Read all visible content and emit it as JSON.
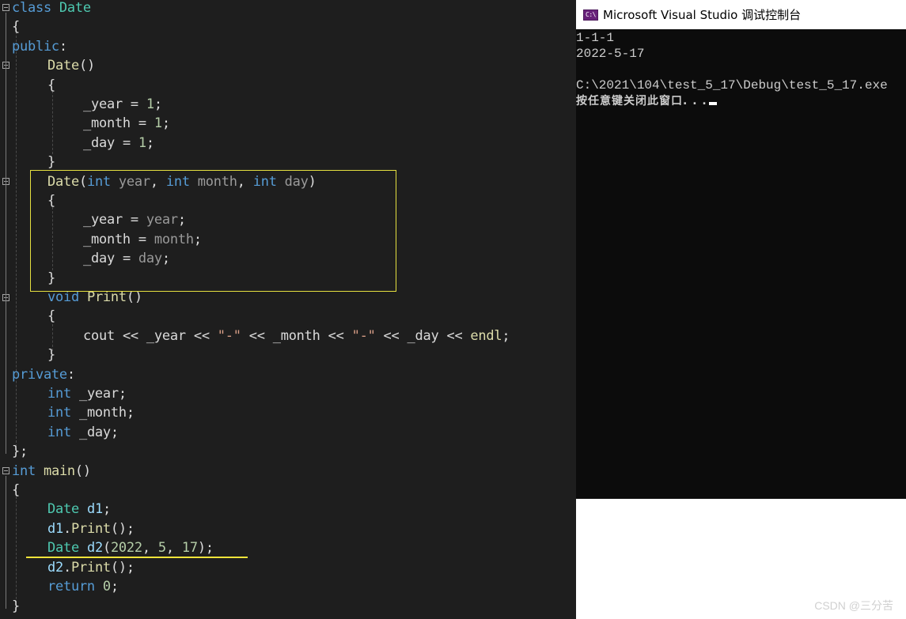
{
  "editor": {
    "lines": [
      [
        "class ",
        "Date"
      ],
      [
        "{"
      ],
      [
        "public",
        ":"
      ],
      [
        "Date",
        "()"
      ],
      [
        "{"
      ],
      [
        "_year",
        " = ",
        "1",
        ";"
      ],
      [
        "_month",
        " = ",
        "1",
        ";"
      ],
      [
        "_day",
        " = ",
        "1",
        ";"
      ],
      [
        "}"
      ],
      [
        "Date",
        "(",
        "int",
        " year",
        ", ",
        "int",
        " month",
        ", ",
        "int",
        " day",
        ")"
      ],
      [
        "{"
      ],
      [
        "_year",
        " = ",
        "year",
        ";"
      ],
      [
        "_month",
        " = ",
        "month",
        ";"
      ],
      [
        "_day",
        " = ",
        "day",
        ";"
      ],
      [
        "}"
      ],
      [
        "void",
        " ",
        "Print",
        "()"
      ],
      [
        "{"
      ],
      [
        "cout",
        " << ",
        "_year",
        " << ",
        "\"-\"",
        " << ",
        "_month",
        " << ",
        "\"-\"",
        " << ",
        "_day",
        " << ",
        "endl",
        ";"
      ],
      [
        "}"
      ],
      [
        "private",
        ":"
      ],
      [
        "int",
        " _year;"
      ],
      [
        "int",
        " _month;"
      ],
      [
        "int",
        " _day;"
      ],
      [
        "};"
      ],
      [
        "int",
        " ",
        "main",
        "()"
      ],
      [
        "{"
      ],
      [
        "Date",
        " ",
        "d1",
        ";"
      ],
      [
        "d1",
        ".",
        "Print",
        "();"
      ],
      [
        "Date",
        " ",
        "d2",
        "(",
        "2022",
        ", ",
        "5",
        ", ",
        "17",
        ");"
      ],
      [
        "d2",
        ".",
        "Print",
        "();"
      ],
      [
        "return",
        " ",
        "0",
        ";"
      ],
      [
        "}"
      ]
    ]
  },
  "console": {
    "title": "Microsoft Visual Studio 调试控制台",
    "icon_text": "C:\\",
    "icon_name": "visual-studio-console-icon",
    "output": [
      "1-1-1",
      "2022-5-17",
      "",
      "C:\\2021\\104\\test_5_17\\Debug\\test_5_17.exe"
    ],
    "prompt": "按任意键关闭此窗口. . ."
  },
  "watermark": "CSDN @三分苦",
  "colors": {
    "editor_bg": "#1e1e1e",
    "keyword": "#569cd6",
    "type": "#4ec9b0",
    "function": "#dcdcaa",
    "number": "#b5cea8",
    "string": "#d69d85",
    "highlight_box": "#e6e040",
    "console_bg": "#0c0c0c"
  }
}
